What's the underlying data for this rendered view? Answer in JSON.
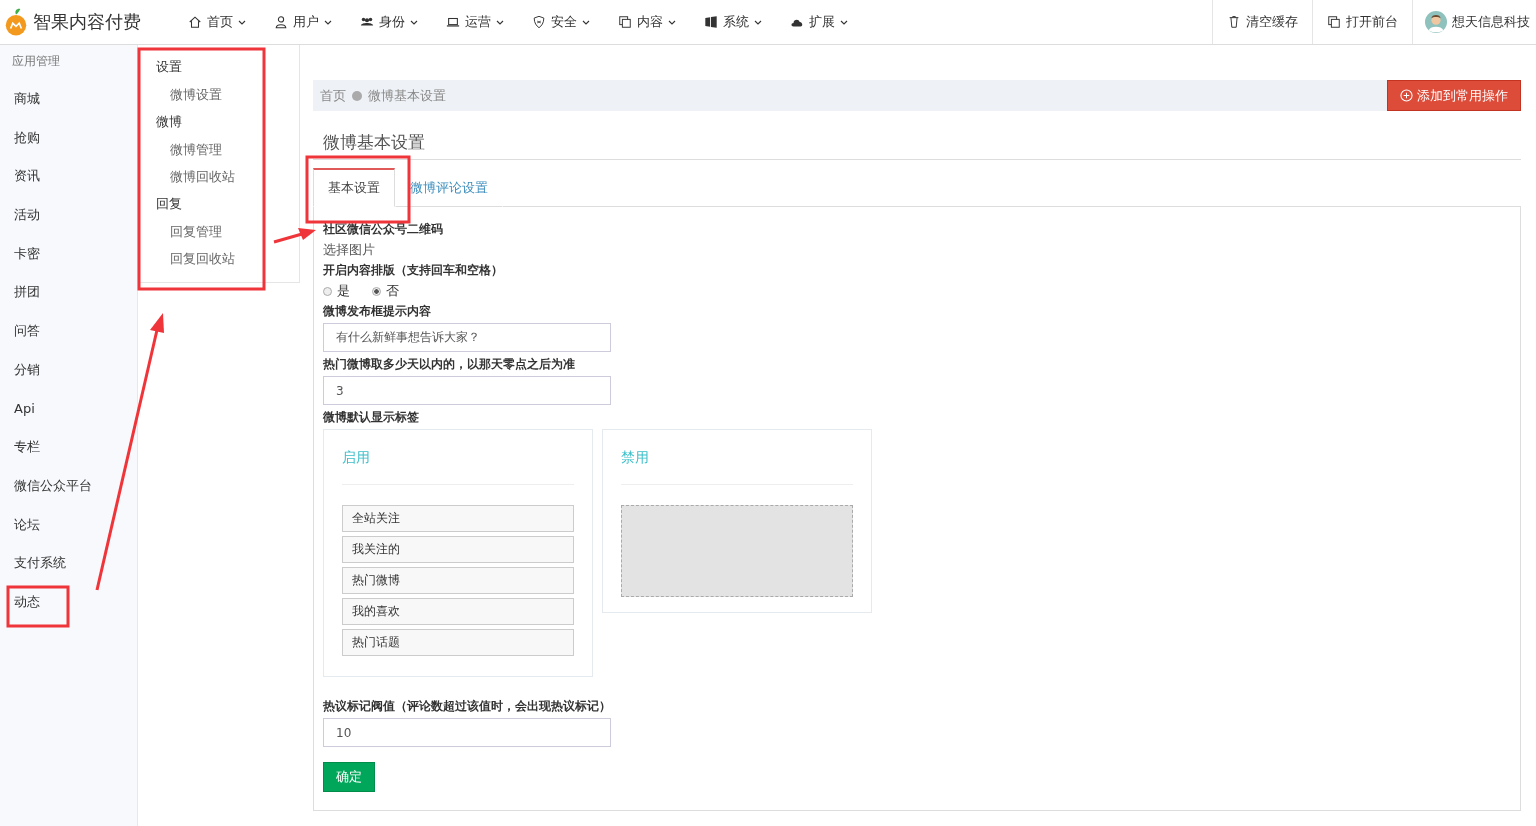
{
  "brand": {
    "name": "智果内容付费"
  },
  "nav": [
    {
      "label": "首页"
    },
    {
      "label": "用户"
    },
    {
      "label": "身份"
    },
    {
      "label": "运营"
    },
    {
      "label": "安全"
    },
    {
      "label": "内容"
    },
    {
      "label": "系统"
    },
    {
      "label": "扩展"
    }
  ],
  "top_actions": [
    {
      "label": "清空缓存"
    },
    {
      "label": "打开前台"
    }
  ],
  "user": {
    "name": "想天信息科技"
  },
  "sidebar": {
    "heading": "应用管理",
    "items": [
      "商城",
      "抢购",
      "资讯",
      "活动",
      "卡密",
      "拼团",
      "问答",
      "分销",
      "Api",
      "专栏",
      "微信公众平台",
      "论坛",
      "支付系统",
      "动态"
    ]
  },
  "submenu": [
    {
      "title": "设置",
      "children": [
        "微博设置"
      ]
    },
    {
      "title": "微博",
      "children": [
        "微博管理",
        "微博回收站"
      ]
    },
    {
      "title": "回复",
      "children": [
        "回复管理",
        "回复回收站"
      ]
    }
  ],
  "breadcrumb": [
    "首页",
    "微博基本设置"
  ],
  "add_button": "添加到常用操作",
  "page_title": "微博基本设置",
  "tabs": [
    {
      "label": "基本设置",
      "selected": true
    },
    {
      "label": "微博评论设置",
      "selected": false
    }
  ],
  "form": {
    "qr_label": "社区微信公众号二维码",
    "qr_link": "选择图片",
    "layout_label": "开启内容排版（支持回车和空格）",
    "layout_options": [
      {
        "label": "是",
        "selected": false
      },
      {
        "label": "否",
        "selected": true
      }
    ],
    "hint_field": {
      "label": "微博发布框提示内容",
      "value": "有什么新鲜事想告诉大家？"
    },
    "days_field": {
      "label": "热门微博取多少天以内的，以那天零点之后为准",
      "value": "3"
    },
    "tags_label": "微博默认显示标签",
    "enabled_title": "启用",
    "enabled_tags": [
      "全站关注",
      "我关注的",
      "热门微博",
      "我的喜欢",
      "热门话题"
    ],
    "disabled_title": "禁用",
    "hot_field": {
      "label": "热议标记阀值（评论数超过该值时，会出现热议标记）",
      "value": "10"
    },
    "submit": "确定"
  }
}
